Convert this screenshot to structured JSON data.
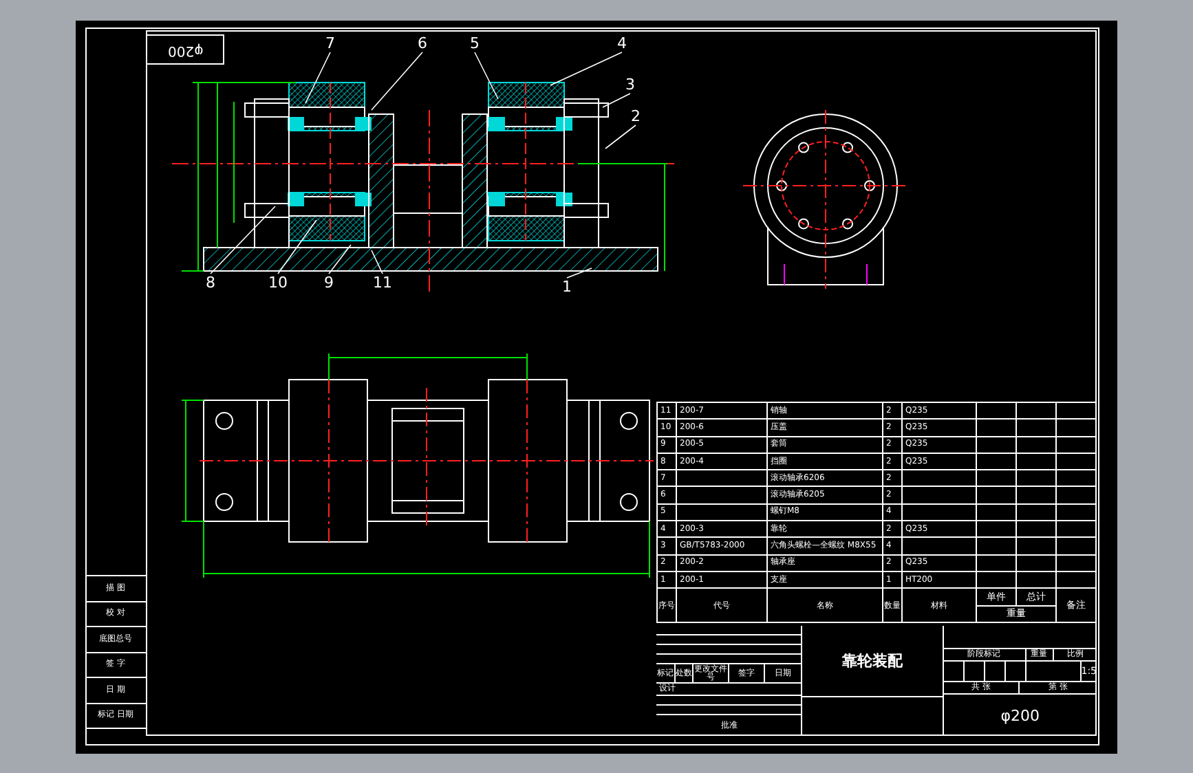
{
  "view_label": "φ200",
  "balloons": [
    {
      "label": "7"
    },
    {
      "label": "6"
    },
    {
      "label": "5"
    },
    {
      "label": "4"
    },
    {
      "label": "3"
    },
    {
      "label": "2"
    },
    {
      "label": "8"
    },
    {
      "label": "10"
    },
    {
      "label": "9"
    },
    {
      "label": "11"
    },
    {
      "label": "1"
    }
  ],
  "parts_list": {
    "columns": [
      "序号",
      "代号",
      "名称",
      "数量",
      "材料",
      "单件",
      "总计",
      "备注"
    ],
    "weight_label": "重量",
    "rows": [
      {
        "no": "11",
        "code": "200-7",
        "name": "销轴",
        "qty": "2",
        "material": "Q235"
      },
      {
        "no": "10",
        "code": "200-6",
        "name": "压盖",
        "qty": "2",
        "material": "Q235"
      },
      {
        "no": "9",
        "code": "200-5",
        "name": "套筒",
        "qty": "2",
        "material": "Q235"
      },
      {
        "no": "8",
        "code": "200-4",
        "name": "挡圈",
        "qty": "2",
        "material": "Q235"
      },
      {
        "no": "7",
        "code": "",
        "name": "滚动轴承6206",
        "qty": "2",
        "material": ""
      },
      {
        "no": "6",
        "code": "",
        "name": "滚动轴承6205",
        "qty": "2",
        "material": ""
      },
      {
        "no": "5",
        "code": "",
        "name": "螺钉M8",
        "qty": "4",
        "material": ""
      },
      {
        "no": "4",
        "code": "200-3",
        "name": "靠轮",
        "qty": "2",
        "material": "Q235"
      },
      {
        "no": "3",
        "code": "GB/T5783-2000",
        "name": "六角头螺栓—全螺纹 M8X55",
        "qty": "4",
        "material": ""
      },
      {
        "no": "2",
        "code": "200-2",
        "name": "轴承座",
        "qty": "2",
        "material": "Q235"
      },
      {
        "no": "1",
        "code": "200-1",
        "name": "支座",
        "qty": "1",
        "material": "HT200"
      }
    ]
  },
  "title_block": {
    "title": "靠轮装配",
    "revision_headers": [
      "标记",
      "处数",
      "更改文件号",
      "签字",
      "日期"
    ],
    "designer_label": "设计",
    "approver_label": "批准",
    "stage_label": "阶段标记",
    "weight_label": "重量",
    "scale_label": "比例",
    "scale": "1:5",
    "sheets_total": "共 张",
    "sheet_no": "第 张",
    "drawing_no": "φ200"
  },
  "left_strip": [
    "描 图",
    "校 对",
    "底图总号",
    "签 字",
    "日 期",
    "标记 日期"
  ]
}
